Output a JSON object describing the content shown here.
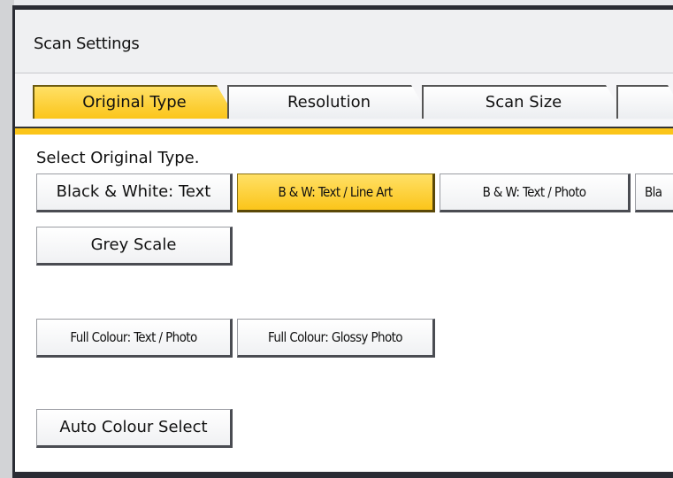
{
  "window": {
    "title": "Scan Settings"
  },
  "tabs": [
    {
      "label": "Original Type",
      "active": true
    },
    {
      "label": "Resolution",
      "active": false
    },
    {
      "label": "Scan Size",
      "active": false
    }
  ],
  "content": {
    "instruction": "Select Original Type.",
    "buttons": {
      "bw_text": "Black & White: Text",
      "bw_text_line_art": "B & W: Text / Line Art",
      "bw_text_photo": "B & W: Text / Photo",
      "bw_cut": "Bla",
      "grey_scale": "Grey Scale",
      "full_colour_text_photo": "Full Colour: Text / Photo",
      "full_colour_glossy_photo": "Full Colour: Glossy Photo",
      "auto_colour_select": "Auto Colour Select"
    },
    "selected": "B & W: Text / Line Art"
  },
  "colors": {
    "accent": "#fbc51a",
    "frame": "#2a2c34"
  }
}
